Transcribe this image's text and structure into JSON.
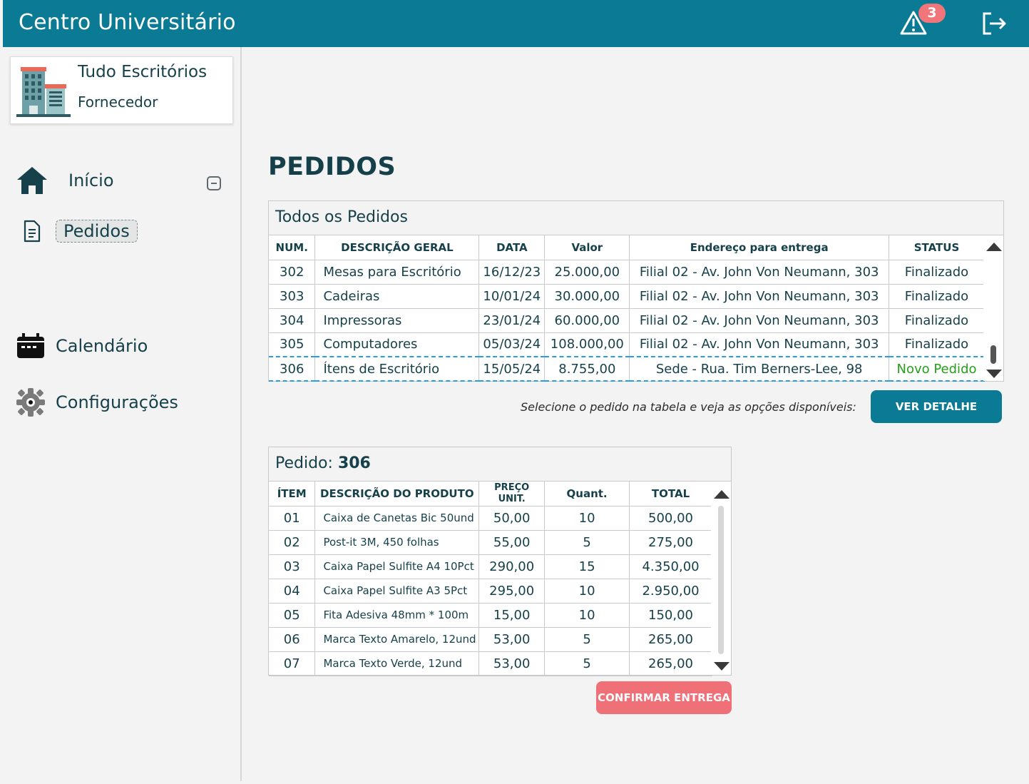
{
  "header": {
    "title": "Centro Universitário",
    "alert_count": "3",
    "alert_icon": "warning-icon",
    "logout_icon": "logout-icon"
  },
  "supplier": {
    "name": "Tudo Escritórios",
    "role": "Fornecedor"
  },
  "nav": {
    "home": "Início",
    "orders": "Pedidos",
    "calendar": "Calendário",
    "settings": "Configurações"
  },
  "page": {
    "title": "PEDIDOS"
  },
  "orders_panel": {
    "title": "Todos os Pedidos",
    "columns": [
      "NUM.",
      "DESCRIÇÃO GERAL",
      "DATA",
      "Valor",
      "Endereço para entrega",
      "STATUS"
    ],
    "rows": [
      {
        "num": "302",
        "desc": "Mesas para Escritório",
        "date": "16/12/23",
        "value": "25.000,00",
        "address": "Filial 02 - Av. John Von Neumann, 303",
        "status": "Finalizado"
      },
      {
        "num": "303",
        "desc": "Cadeiras",
        "date": "10/01/24",
        "value": "30.000,00",
        "address": "Filial 02 - Av. John Von Neumann, 303",
        "status": "Finalizado"
      },
      {
        "num": "304",
        "desc": "Impressoras",
        "date": "23/01/24",
        "value": "60.000,00",
        "address": "Filial 02 - Av. John Von Neumann, 303",
        "status": "Finalizado"
      },
      {
        "num": "305",
        "desc": "Computadores",
        "date": "05/03/24",
        "value": "108.000,00",
        "address": "Filial 02 - Av. John Von Neumann, 303",
        "status": "Finalizado"
      },
      {
        "num": "306",
        "desc": "Ítens de Escritório",
        "date": "15/05/24",
        "value": "8.755,00",
        "address": "Sede - Rua. Tim Berners-Lee, 98",
        "status": "Novo Pedido"
      }
    ],
    "hint": "Selecione o pedido na tabela e veja as opções disponíveis:",
    "detail_button": "VER DETALHE"
  },
  "items_panel": {
    "title_prefix": "Pedido:",
    "order_number": "306",
    "columns": [
      "ÍTEM",
      "DESCRIÇÃO DO PRODUTO",
      "PREÇO UNIT.",
      "Quant.",
      "TOTAL"
    ],
    "rows": [
      {
        "item": "01",
        "desc": "Caixa de Canetas Bic 50und",
        "price": "50,00",
        "qty": "10",
        "total": "500,00"
      },
      {
        "item": "02",
        "desc": "Post-it 3M, 450 folhas",
        "price": "55,00",
        "qty": "5",
        "total": "275,00"
      },
      {
        "item": "03",
        "desc": "Caixa Papel Sulfite A4 10Pct",
        "price": "290,00",
        "qty": "15",
        "total": "4.350,00"
      },
      {
        "item": "04",
        "desc": "Caixa Papel Sulfite A3 5Pct",
        "price": "295,00",
        "qty": "10",
        "total": "2.950,00"
      },
      {
        "item": "05",
        "desc": "Fita Adesiva 48mm * 100m",
        "price": "15,00",
        "qty": "10",
        "total": "150,00"
      },
      {
        "item": "06",
        "desc": "Marca Texto Amarelo, 12und",
        "price": "53,00",
        "qty": "5",
        "total": "265,00"
      },
      {
        "item": "07",
        "desc": "Marca Texto Verde, 12und",
        "price": "53,00",
        "qty": "5",
        "total": "265,00"
      }
    ],
    "confirm_button": "CONFIRMAR ENTREGA"
  },
  "colors": {
    "primary": "#0b7a94",
    "danger": "#f07077",
    "new_status": "#24a019",
    "text": "#16414b"
  }
}
